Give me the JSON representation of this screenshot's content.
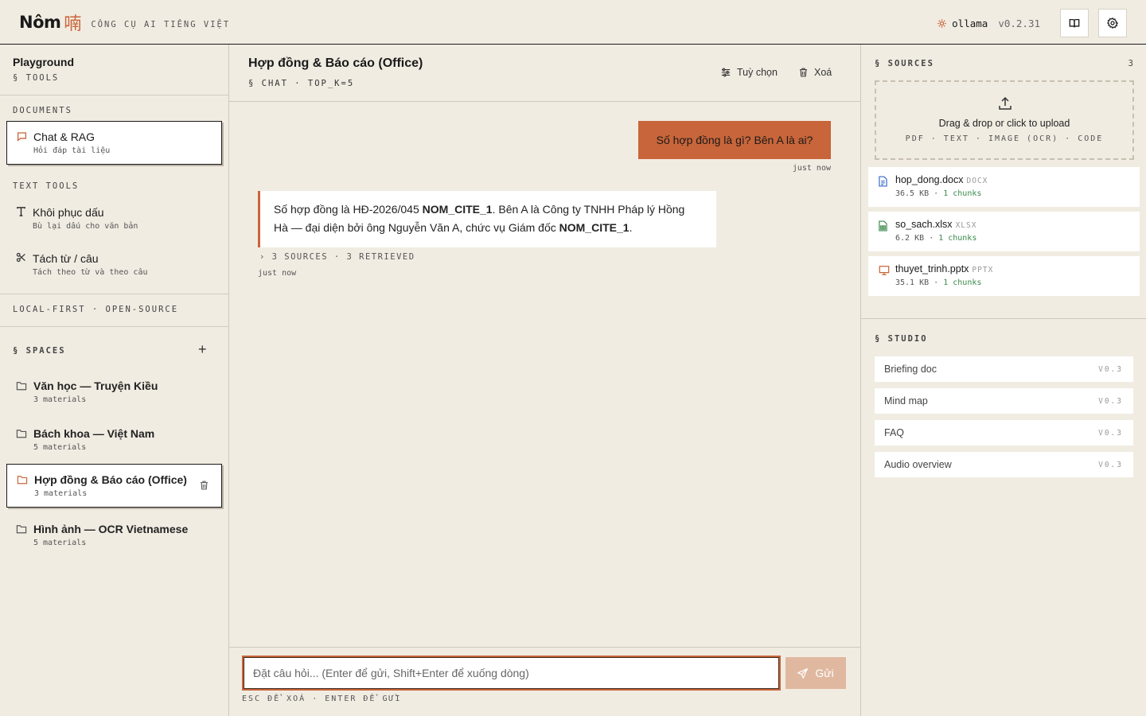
{
  "header": {
    "brand": "Nôm",
    "brand_glyph": "喃",
    "tagline": "CÔNG CỤ AI TIẾNG VIỆT",
    "engine": "ollama",
    "version": "v0.2.31",
    "icons": [
      "engine-icon",
      "book-icon",
      "gear-icon"
    ]
  },
  "sidebar": {
    "title": "Playground",
    "tools_label": "§ TOOLS",
    "documents_label": "DOCUMENTS",
    "documents": [
      {
        "title": "Chat & RAG",
        "subtitle": "Hỏi đáp tài liệu",
        "icon": "chat-icon",
        "active": true
      }
    ],
    "text_tools_label": "TEXT TOOLS",
    "text_tools": [
      {
        "title": "Khôi phục dấu",
        "subtitle": "Bù lại dấu cho văn bản",
        "icon": "text-icon"
      },
      {
        "title": "Tách từ / câu",
        "subtitle": "Tách theo từ và theo câu",
        "icon": "scissors-icon"
      }
    ],
    "footer_note": "LOCAL-FIRST · OPEN-SOURCE",
    "spaces_label": "§ SPACES",
    "add_label": "+",
    "spaces": [
      {
        "title": "Văn học — Truyện Kiều",
        "subtitle": "3 materials"
      },
      {
        "title": "Bách khoa — Việt Nam",
        "subtitle": "5 materials"
      },
      {
        "title": "Hợp đồng & Báo cáo (Office)",
        "subtitle": "3 materials",
        "active": true
      },
      {
        "title": "Hình ảnh — OCR Vietnamese",
        "subtitle": "5 materials"
      }
    ]
  },
  "main": {
    "title": "Hợp đồng & Báo cáo (Office)",
    "subtitle": "§ CHAT · TOP_K=5",
    "options_label": "Tuỳ chọn",
    "clear_label": "Xoá",
    "user_message": "Số hợp đồng là gì? Bên A là ai?",
    "user_time": "just now",
    "assistant_parts": {
      "p1": "Số hợp đồng là HĐ-2026/045 ",
      "cite1": "NOM_CITE_1",
      "p2": ". Bên A là Công ty TNHH Pháp lý Hồng Hà — đại diện bởi ông Nguyễn Văn A, chức vụ Giám đốc ",
      "cite2": "NOM_CITE_1",
      "p3": "."
    },
    "sources_line": "› 3 SOURCES · 3 RETRIEVED",
    "assistant_time": "just now",
    "composer_placeholder": "Đặt câu hỏi... (Enter để gửi, Shift+Enter để xuống dòng)",
    "send_label": "Gửi",
    "hint": "ESC ĐỂ XOÁ · ENTER ĐỂ GỬI"
  },
  "right": {
    "sources_label": "§ SOURCES",
    "sources_count": "3",
    "upload_text": "Drag & drop or click to upload",
    "upload_types": "PDF · TEXT · IMAGE (OCR) · CODE",
    "files": [
      {
        "name": "hop_dong.docx",
        "type": "DOCX",
        "size": "36.5 KB",
        "chunks": "1 chunks",
        "icon": "doc-file-icon",
        "color": "#3a6ac8"
      },
      {
        "name": "so_sach.xlsx",
        "type": "XLSX",
        "size": "6.2 KB",
        "chunks": "1 chunks",
        "icon": "sheet-file-icon",
        "color": "#3a8a4a"
      },
      {
        "name": "thuyet_trinh.pptx",
        "type": "PPTX",
        "size": "35.1 KB",
        "chunks": "1 chunks",
        "icon": "slides-file-icon",
        "color": "#c8653a"
      }
    ],
    "studio_label": "§ STUDIO",
    "studio": [
      {
        "name": "Briefing doc",
        "version": "V0.3"
      },
      {
        "name": "Mind map",
        "version": "V0.3"
      },
      {
        "name": "FAQ",
        "version": "V0.3"
      },
      {
        "name": "Audio overview",
        "version": "V0.3"
      }
    ]
  },
  "colors": {
    "background": "#f1ece2",
    "accent": "#c8653a",
    "send_disabled": "#e0b8a0",
    "chunks_green": "#3a8a4a"
  }
}
